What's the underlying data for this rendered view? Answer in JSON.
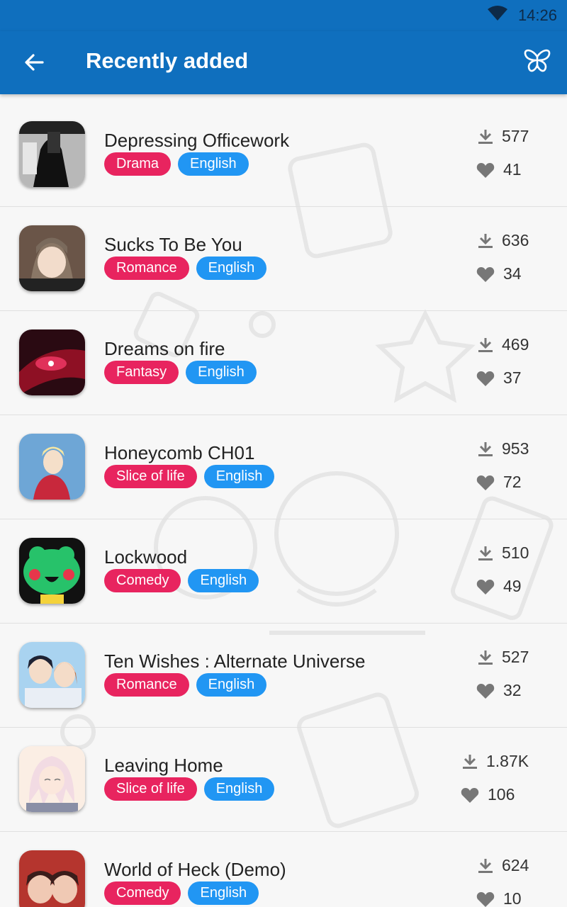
{
  "status": {
    "time": "14:26"
  },
  "appbar": {
    "title": "Recently added"
  },
  "items": [
    {
      "name": "Depressing Officework",
      "genre": "Drama",
      "language": "English",
      "downloads": "577",
      "likes": "41"
    },
    {
      "name": "Sucks To Be You",
      "genre": "Romance",
      "language": "English",
      "downloads": "636",
      "likes": "34"
    },
    {
      "name": "Dreams on fire",
      "genre": "Fantasy",
      "language": "English",
      "downloads": "469",
      "likes": "37"
    },
    {
      "name": "Honeycomb CH01",
      "genre": "Slice of life",
      "language": "English",
      "downloads": "953",
      "likes": "72"
    },
    {
      "name": "Lockwood",
      "genre": "Comedy",
      "language": "English",
      "downloads": "510",
      "likes": "49"
    },
    {
      "name": "Ten Wishes : Alternate Universe",
      "genre": "Romance",
      "language": "English",
      "downloads": "527",
      "likes": "32"
    },
    {
      "name": "Leaving Home",
      "genre": "Slice of life",
      "language": "English",
      "downloads": "1.87K",
      "likes": "106"
    },
    {
      "name": "World of Heck (Demo)",
      "genre": "Comedy",
      "language": "English",
      "downloads": "624",
      "likes": "10"
    }
  ],
  "icons": {
    "back": "arrow-left-icon",
    "butterfly": "butterfly-icon",
    "wifi": "wifi-icon",
    "download": "download-icon",
    "like": "heart-icon"
  },
  "colors": {
    "primary": "#0f6fbe",
    "genre_tag": "#e8245f",
    "language_tag": "#2196f3"
  }
}
